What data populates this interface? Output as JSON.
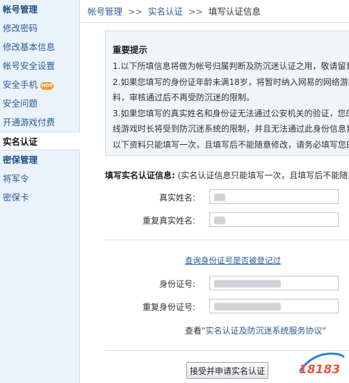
{
  "sidebar": {
    "groups": [
      {
        "title": "帐号管理",
        "items": [
          {
            "label": "修改密码"
          },
          {
            "label": "修改基本信息"
          },
          {
            "label": "帐号安全设置"
          },
          {
            "label": "安全手机",
            "badge": "HOT"
          },
          {
            "label": "安全问题"
          },
          {
            "label": "开通游戏付费"
          },
          {
            "label": "实名认证",
            "active": true
          }
        ]
      },
      {
        "title": "密保管理",
        "items": [
          {
            "label": "将军令"
          },
          {
            "label": "密保卡"
          }
        ]
      }
    ]
  },
  "breadcrumb": {
    "items": [
      "帐号管理",
      "实名认证"
    ],
    "separator": ">>",
    "current": "填写认证信息"
  },
  "notice": {
    "title": "重要提示",
    "lines": [
      "1.以下所填信息将做为帐号归属判断及防沉迷认证之用，敬请留意。",
      "2.如果您填写的身份证年龄未满18岁，将暂时纳入网易的网络游戏防",
      "料，审核通过后不再受防沉迷的限制。",
      "3.如果您填写的真实姓名和身份证无法通过公安机关的验证，您的帐",
      "线游戏时长将受到防沉迷系统的限制，并且无法通过此身份信息判断",
      "以下资料只能填写一次，且填写后不能随意修改，请务必填写您的真"
    ]
  },
  "form": {
    "title_bold": "填写实名认证信息:",
    "title_note": " (实名认证信息只能填写一次，且填写后不能随意",
    "fields": [
      {
        "label": "真实姓名:"
      },
      {
        "label": "重复真实姓名:"
      },
      {
        "label": "身份证号:"
      },
      {
        "label": "重复身份证号:"
      }
    ],
    "query_link": "查询身份证号是否被登记过",
    "agreement_prefix": "查看",
    "agreement_link": "\"实名认证及防沉迷系统服务协议\"",
    "submit_label": "接受并申请实名认证"
  },
  "watermark": {
    "text": "18183",
    "color_primary": "#e8563b",
    "color_secondary": "#2a7fd4"
  },
  "colors": {
    "link": "#2a5a94",
    "sidebar_bg": "#eaf2fb",
    "hot_badge": "#f29a2e"
  }
}
